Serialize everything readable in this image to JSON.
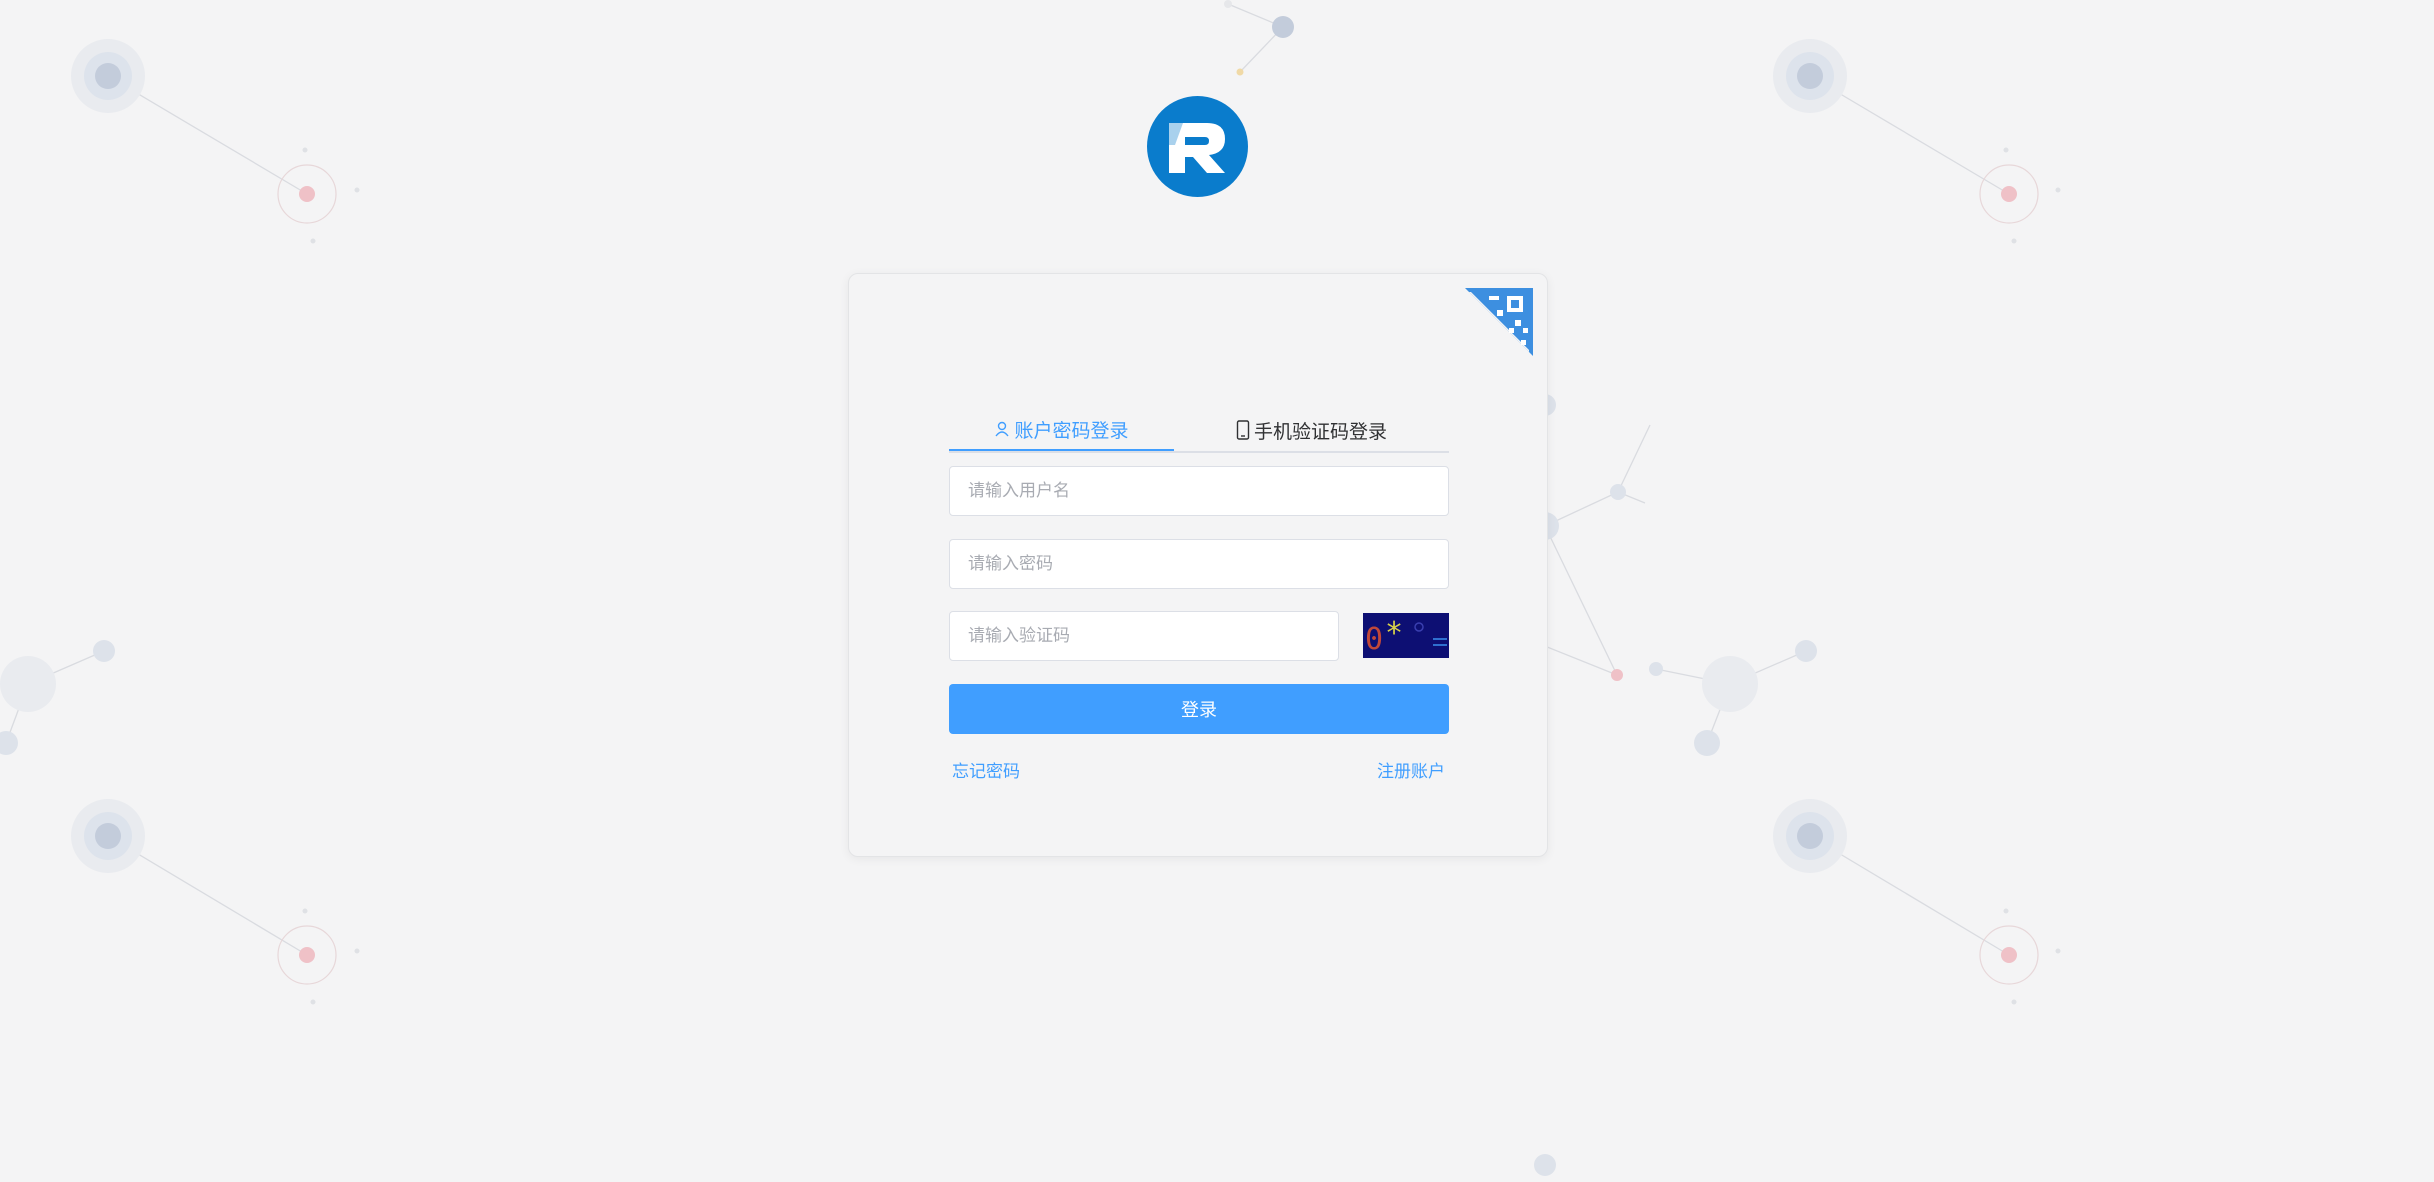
{
  "colors": {
    "background": "#f4f4f5",
    "accent": "#409eff",
    "logo": "#0a7ccc",
    "captcha_bg": "#0d0f73"
  },
  "logo": {
    "icon": "r-logo-icon"
  },
  "qr_login": {
    "icon": "qr-code-icon"
  },
  "tabs": [
    {
      "label": "账户密码登录",
      "icon": "user-icon",
      "active": true
    },
    {
      "label": "手机验证码登录",
      "icon": "mobile-phone-icon",
      "active": false
    }
  ],
  "form": {
    "username_placeholder": "请输入用户名",
    "password_placeholder": "请输入密码",
    "captcha_placeholder": "请输入验证码",
    "captcha_text": "0*"
  },
  "login_label": "登录",
  "links": {
    "forgot_password": "忘记密码",
    "register": "注册账户"
  }
}
